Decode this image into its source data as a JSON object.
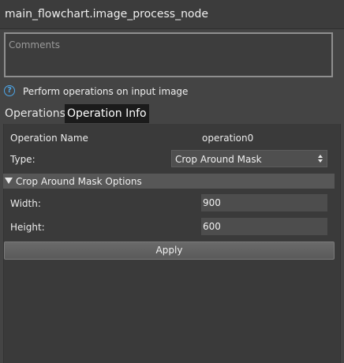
{
  "window": {
    "title": "main_flowchart.image_process_node"
  },
  "comments": {
    "placeholder": "Comments"
  },
  "description": "Perform operations on input image",
  "tabs": [
    {
      "label": "Operations",
      "active": false
    },
    {
      "label": "Operation Info",
      "active": true
    }
  ],
  "operation": {
    "name_label": "Operation Name",
    "name_value": "operation0",
    "type_label": "Type:",
    "type_value": "Crop Around Mask"
  },
  "section": {
    "title": "Crop Around Mask Options",
    "width_label": "Width:",
    "width_value": "900",
    "height_label": "Height:",
    "height_value": "600"
  },
  "apply_label": "Apply",
  "colors": {
    "background": "#444444",
    "help_icon": "#4da6e8",
    "active_tab": "#1b1b1b"
  }
}
